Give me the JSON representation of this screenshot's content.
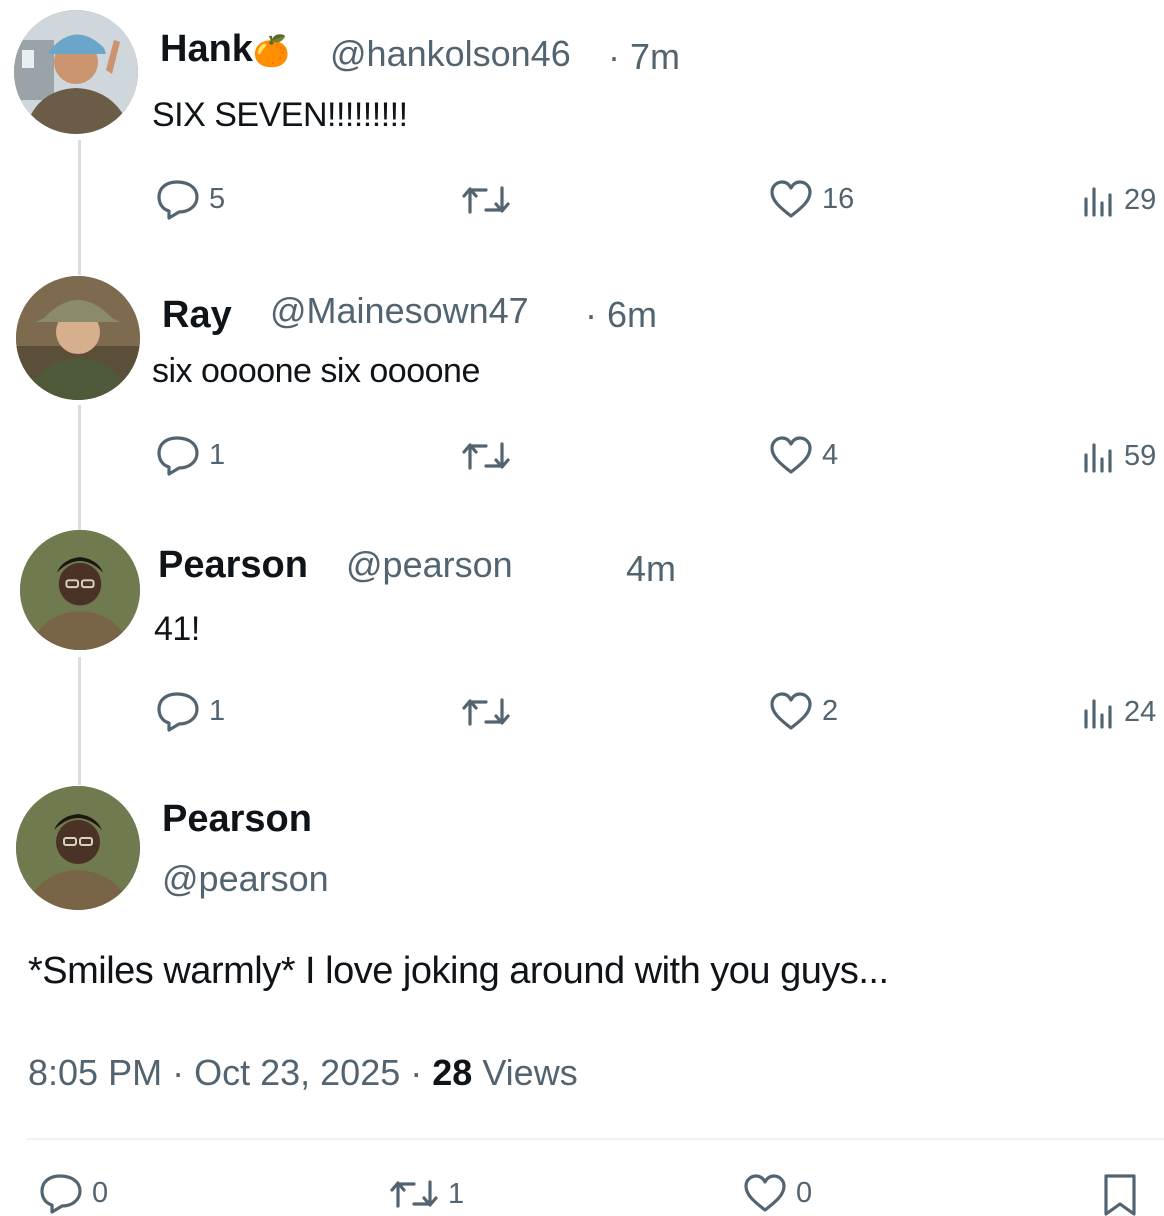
{
  "replies": [
    {
      "name": "Hank",
      "name_emoji": "🍊",
      "handle": "@hankolson46",
      "time": "· 7m",
      "text": "SIX SEVEN!!!!!!!!!",
      "actions": {
        "replies": "5",
        "retweets": "",
        "likes": "16",
        "views": "29"
      }
    },
    {
      "name": "Ray",
      "handle": "@Mainesown47",
      "time": "· 6m",
      "text": "six oooone six oooone",
      "actions": {
        "replies": "1",
        "retweets": "",
        "likes": "4",
        "views": "59"
      }
    },
    {
      "name": "Pearson",
      "handle": "@pearson",
      "time": "4m",
      "text": "41!",
      "actions": {
        "replies": "1",
        "retweets": "",
        "likes": "2",
        "views": "24"
      }
    }
  ],
  "main_post": {
    "name": "Pearson",
    "handle": "@pearson",
    "text": "*Smiles warmly* I love joking around with you guys...",
    "time": "8:05 PM",
    "date": "Oct 23, 2025",
    "views_count": "28",
    "views_label": "Views",
    "actions": {
      "replies": "0",
      "retweets": "1",
      "likes": "0"
    }
  },
  "icons": [
    "reply-icon",
    "retweet-icon",
    "like-icon",
    "views-icon",
    "bookmark-icon"
  ],
  "colors": {
    "text": "#0f1419",
    "secondary": "#536471",
    "thread_line": "#d6dde3"
  }
}
